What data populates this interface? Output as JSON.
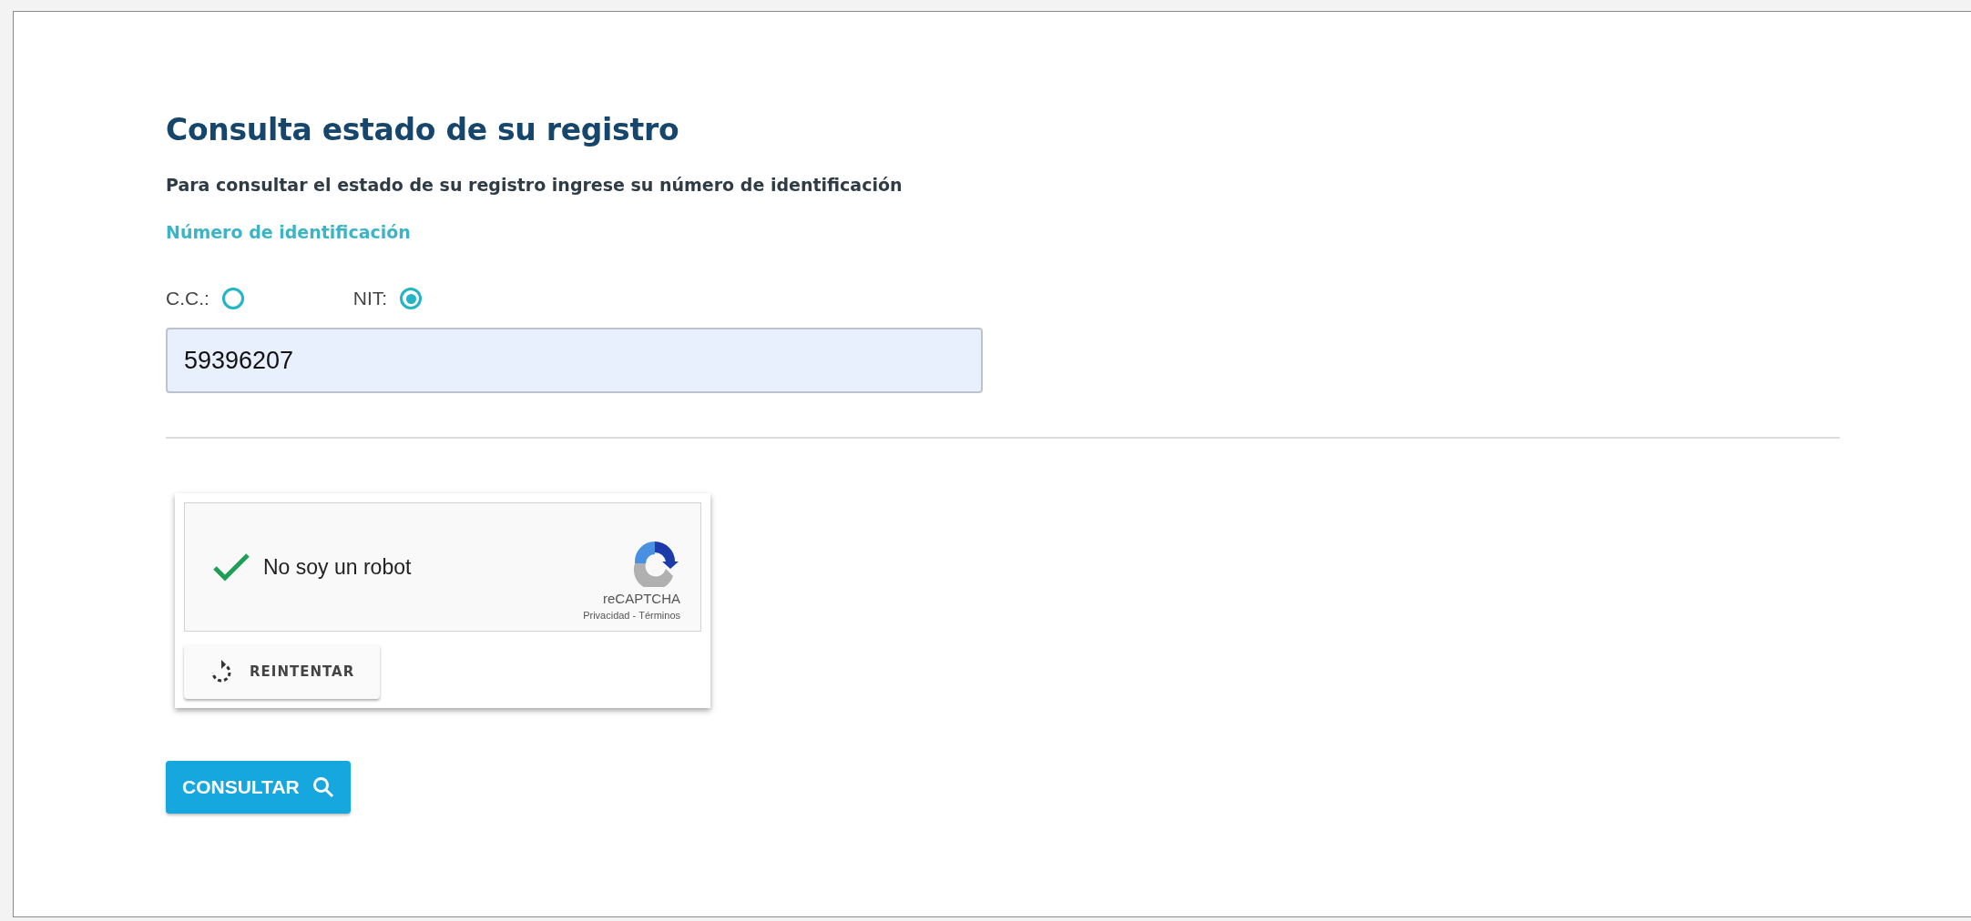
{
  "title": "Consulta estado de su registro",
  "instructions": "Para consultar el estado de su registro ingrese su número de identificación",
  "field_label": "Número de identificación",
  "id_types": [
    {
      "label": "C.C.:",
      "selected": false
    },
    {
      "label": "NIT:",
      "selected": true
    }
  ],
  "id_field": {
    "value": "59396207"
  },
  "captcha": {
    "label": "No soy un robot",
    "checked": true,
    "brand": "reCAPTCHA",
    "privacy_link": "Privacidad",
    "separator": "-",
    "terms_link": "Términos",
    "retry_button": "REINTENTAR"
  },
  "submit_button": "CONSULTAR"
}
